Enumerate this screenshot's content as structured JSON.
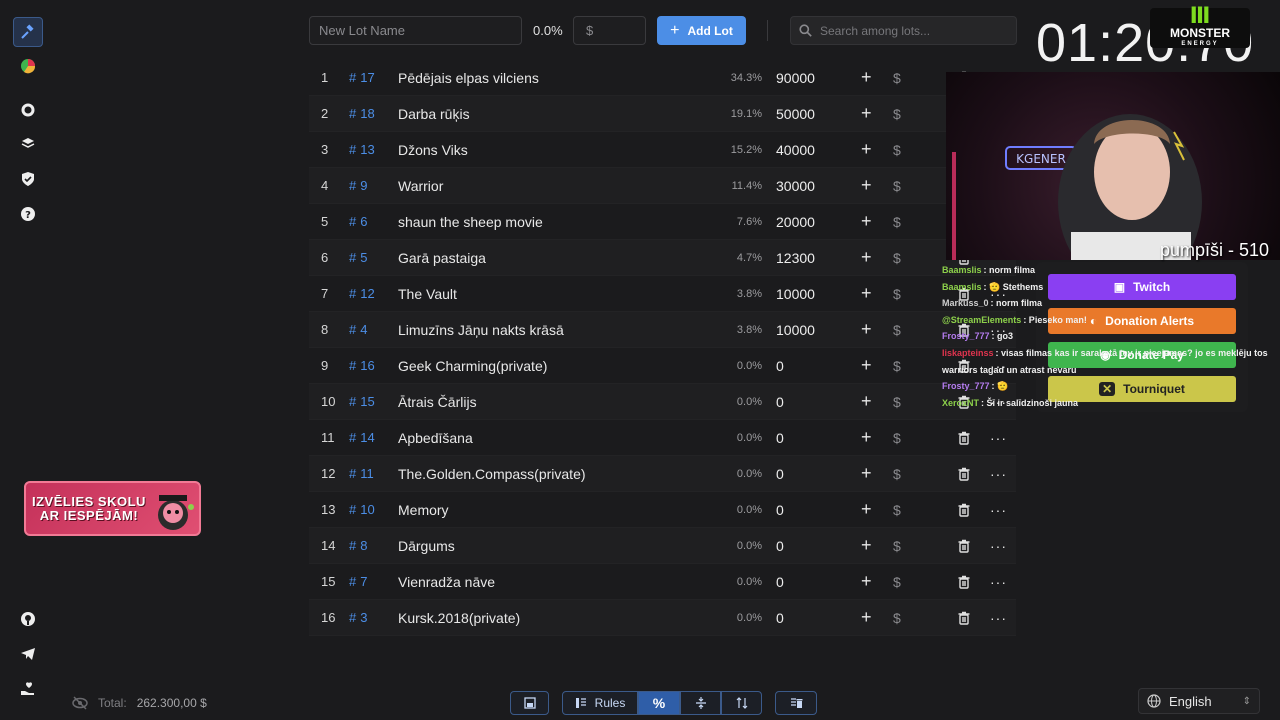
{
  "topbar": {
    "lot_name_placeholder": "New Lot Name",
    "percent": "0.0%",
    "amount_placeholder": "$",
    "add_lot_label": "Add Lot",
    "search_placeholder": "Search among lots..."
  },
  "lots": [
    {
      "index": "1",
      "id": "17",
      "name": "Pēdējais elpas vilciens",
      "percent": "34.3%",
      "amount": "90000"
    },
    {
      "index": "2",
      "id": "18",
      "name": "Darba rūķis",
      "percent": "19.1%",
      "amount": "50000"
    },
    {
      "index": "3",
      "id": "13",
      "name": "Džons Viks",
      "percent": "15.2%",
      "amount": "40000"
    },
    {
      "index": "4",
      "id": "9",
      "name": "Warrior",
      "percent": "11.4%",
      "amount": "30000"
    },
    {
      "index": "5",
      "id": "6",
      "name": "shaun the sheep movie",
      "percent": "7.6%",
      "amount": "20000"
    },
    {
      "index": "6",
      "id": "5",
      "name": "Garā pastaiga",
      "percent": "4.7%",
      "amount": "12300"
    },
    {
      "index": "7",
      "id": "12",
      "name": "The Vault",
      "percent": "3.8%",
      "amount": "10000"
    },
    {
      "index": "8",
      "id": "4",
      "name": "Limuzīns Jāņu nakts krāsā",
      "percent": "3.8%",
      "amount": "10000"
    },
    {
      "index": "9",
      "id": "16",
      "name": "Geek Charming(private)",
      "percent": "0.0%",
      "amount": "0"
    },
    {
      "index": "10",
      "id": "15",
      "name": "Ātrais Čārlijs",
      "percent": "0.0%",
      "amount": "0"
    },
    {
      "index": "11",
      "id": "14",
      "name": "Apbedīšana",
      "percent": "0.0%",
      "amount": "0"
    },
    {
      "index": "12",
      "id": "11",
      "name": "The.Golden.Compass(private)",
      "percent": "0.0%",
      "amount": "0"
    },
    {
      "index": "13",
      "id": "10",
      "name": "Memory",
      "percent": "0.0%",
      "amount": "0"
    },
    {
      "index": "14",
      "id": "8",
      "name": "Dārgums",
      "percent": "0.0%",
      "amount": "0"
    },
    {
      "index": "15",
      "id": "7",
      "name": "Vienradža nāve",
      "percent": "0.0%",
      "amount": "0"
    },
    {
      "index": "16",
      "id": "3",
      "name": "Kursk.2018(private)",
      "percent": "0.0%",
      "amount": "0"
    }
  ],
  "row_symbols": {
    "hash": "#",
    "plus": "+",
    "dollar": "$",
    "more": "···"
  },
  "promo": {
    "line1": "IZVĒLIES SKOLU",
    "line2": "AR IESPĒJĀM!"
  },
  "footer": {
    "total_label": "Total:",
    "total_value": "262.300,00 $",
    "rules_label": "Rules",
    "percent_symbol": "%",
    "language": "English"
  },
  "overlay": {
    "clock": "01:20:70",
    "sponsor_line1": "MONSTER",
    "sponsor_line2": "ENERGY",
    "cam_caption": "pumpīši - 510",
    "buttons": [
      "Twitch",
      "Donation Alerts",
      "Donate Pay",
      "Tourniquet"
    ],
    "chat": [
      {
        "user": "Baamslis",
        "color": "#8dd14b",
        "text": ": norm filma"
      },
      {
        "user": "Baamslis",
        "color": "#8dd14b",
        "text": ": 🫡 Stethems"
      },
      {
        "user": "Markuss_0",
        "color": "#cfcfcf",
        "text": ": norm filma"
      },
      {
        "user": "@StreamElements",
        "color": "#8dd14b",
        "text": ": Pieseko man!"
      },
      {
        "user": "Frosty_777",
        "color": "#b57cf0",
        "text": ": go3"
      },
      {
        "user": "Iiskapteinss",
        "color": "#e0344e",
        "text": ": visas filmas kas ir sarakstā tev ir pieejamas? jo es meklēju tos warriors tagad un atrast nevaru"
      },
      {
        "user": "Frosty_777",
        "color": "#b57cf0",
        "text": ": 🫡"
      },
      {
        "user": "XeroxNT",
        "color": "#8dd14b",
        "text": ": Šī ir salīdzinoši jauna"
      }
    ]
  },
  "colors": {
    "accent": "#4c8ee6",
    "background": "#1b1b1d",
    "twitch": "#8a3ff2",
    "donation_alerts": "#e9792a",
    "donate_pay": "#3fb54e",
    "tourniquet": "#cbc64a"
  }
}
